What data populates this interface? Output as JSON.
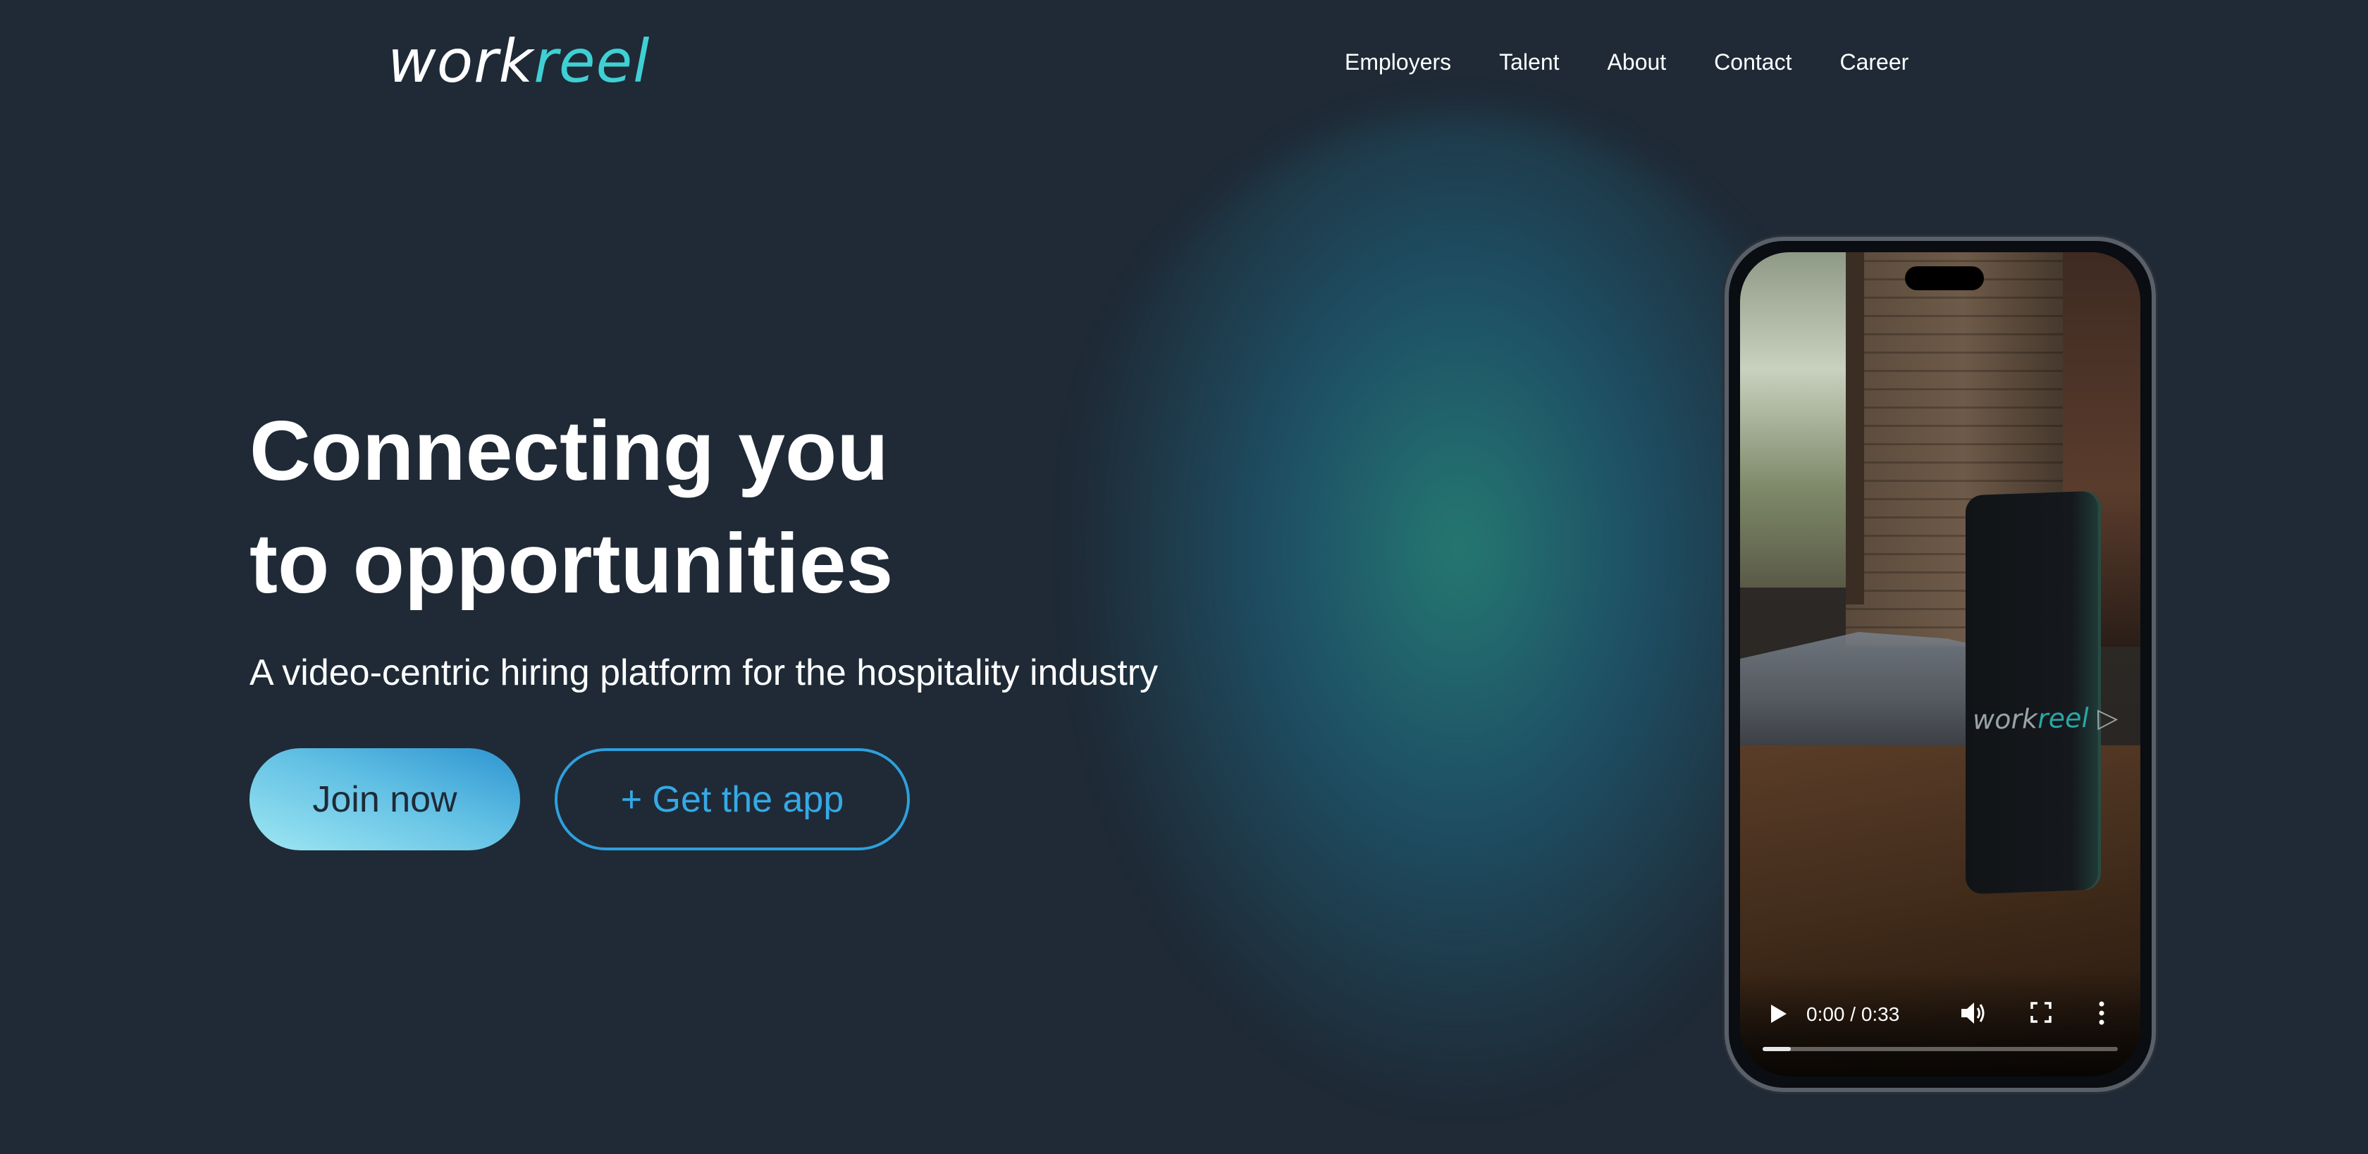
{
  "header": {
    "logo": {
      "part1": "work",
      "part2": "reel"
    },
    "nav": [
      {
        "label": "Employers"
      },
      {
        "label": "Talent"
      },
      {
        "label": "About"
      },
      {
        "label": "Contact"
      },
      {
        "label": "Career"
      }
    ]
  },
  "hero": {
    "headline_line1": "Connecting you",
    "headline_line2": "to opportunities",
    "subtitle": "A video-centric hiring platform for the hospitality industry",
    "primary_button": "Join now",
    "secondary_button": "+ Get the app"
  },
  "video": {
    "time_display": "0:00 / 0:33",
    "progress_percent": 8,
    "screen_logo": {
      "part1": "work",
      "part2": "reel"
    },
    "icons": [
      "play-icon",
      "volume-icon",
      "fullscreen-icon",
      "more-options-icon"
    ]
  },
  "colors": {
    "background": "#1f2a36",
    "accent_teal": "#3fd0d4",
    "accent_blue": "#2f9fdc"
  }
}
